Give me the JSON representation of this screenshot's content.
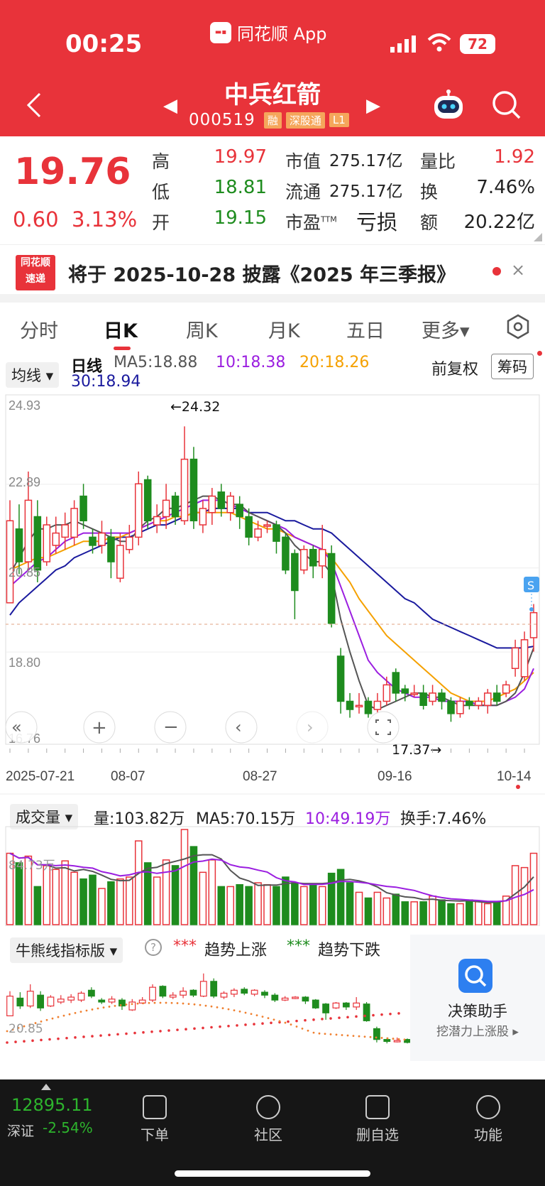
{
  "status_bar": {
    "time": "00:25",
    "battery": "72",
    "app_label": "同花顺 App"
  },
  "header": {
    "stock_name": "中兵红箭",
    "stock_code": "000519",
    "tags": [
      "融",
      "深股通",
      "L1"
    ]
  },
  "quote": {
    "price": "19.76",
    "change": "0.60",
    "change_pct": "3.13%",
    "items": [
      {
        "label": "高",
        "value": "19.97",
        "color": "red"
      },
      {
        "label": "低",
        "value": "18.81",
        "color": "green"
      },
      {
        "label": "开",
        "value": "19.15",
        "color": "green"
      },
      {
        "label": "市值",
        "value": "275.17亿"
      },
      {
        "label": "流通",
        "value": "275.17亿"
      },
      {
        "label": "市盈",
        "label_sup": "TTM",
        "value": "亏损"
      },
      {
        "label": "量比",
        "value": "1.92",
        "color": "red"
      },
      {
        "label": "换",
        "value": "7.46%"
      },
      {
        "label": "额",
        "value": "20.22亿"
      }
    ]
  },
  "notice": {
    "logo": "同花顺速递",
    "text": "将于 2025-10-28 披露《2025 年三季报》",
    "close": "×"
  },
  "tabs": [
    "分时",
    "日K",
    "周K",
    "月K",
    "五日",
    "更多▾"
  ],
  "active_tab": "日K",
  "ma_bar": {
    "dropdown": "均线",
    "label": "日线",
    "ma5": "MA5:18.88",
    "ma10": "10:18.38",
    "ma20": "20:18.26",
    "ma30": "30:18.94",
    "adjust": "前复权",
    "chips": "筹码"
  },
  "chart_data": {
    "type": "candlestick",
    "y_ticks": [
      "24.93",
      "22.89",
      "20.85",
      "18.80",
      "16.76"
    ],
    "x_ticks": [
      "2025-07-21",
      "08-07",
      "08-27",
      "09-16",
      "10-14"
    ],
    "annotations": {
      "high": "←24.32",
      "low": "17.37→",
      "marker": "S"
    },
    "candles": [
      [
        20.0,
        22.0,
        20.9,
        22.5
      ],
      [
        21.8,
        21.0,
        20.7,
        22.4
      ],
      [
        21.0,
        22.5,
        20.8,
        23.2
      ],
      [
        22.1,
        20.8,
        20.5,
        22.5
      ],
      [
        21.0,
        21.9,
        20.9,
        22.1
      ],
      [
        21.4,
        21.7,
        21.2,
        22.1
      ],
      [
        21.6,
        21.9,
        21.3,
        22.2
      ],
      [
        21.6,
        22.3,
        21.4,
        22.5
      ],
      [
        22.6,
        22.0,
        21.8,
        22.9
      ],
      [
        21.6,
        21.4,
        21.2,
        21.8
      ],
      [
        21.4,
        21.7,
        21.2,
        22.0
      ],
      [
        21.6,
        21.0,
        20.6,
        21.8
      ],
      [
        20.6,
        21.4,
        20.5,
        21.7
      ],
      [
        21.3,
        21.6,
        21.2,
        21.9
      ],
      [
        21.6,
        22.9,
        21.4,
        23.2
      ],
      [
        23.0,
        22.0,
        21.8,
        23.1
      ],
      [
        21.9,
        22.1,
        21.7,
        22.4
      ],
      [
        22.1,
        22.5,
        21.8,
        22.9
      ],
      [
        22.6,
        22.1,
        21.9,
        22.7
      ],
      [
        22.0,
        23.5,
        21.9,
        24.3
      ],
      [
        23.5,
        22.0,
        21.8,
        23.8
      ],
      [
        21.9,
        22.3,
        21.7,
        22.5
      ],
      [
        22.2,
        22.6,
        21.9,
        22.8
      ],
      [
        22.7,
        22.3,
        22.1,
        22.9
      ],
      [
        22.2,
        22.6,
        22.0,
        22.7
      ],
      [
        22.4,
        22.1,
        21.8,
        22.6
      ],
      [
        22.1,
        21.6,
        21.4,
        22.3
      ],
      [
        21.6,
        21.8,
        21.5,
        22.0
      ],
      [
        21.9,
        21.9,
        21.7,
        22.0
      ],
      [
        21.9,
        21.5,
        21.2,
        22.0
      ],
      [
        21.6,
        20.8,
        20.7,
        21.7
      ],
      [
        21.2,
        20.3,
        19.6,
        21.3
      ],
      [
        20.8,
        21.3,
        20.7,
        21.4
      ],
      [
        21.3,
        20.9,
        20.6,
        21.4
      ],
      [
        20.9,
        21.3,
        20.6,
        21.9
      ],
      [
        21.2,
        19.5,
        19.4,
        21.4
      ],
      [
        18.7,
        17.6,
        17.3,
        18.9
      ],
      [
        17.6,
        17.4,
        17.2,
        17.8
      ],
      [
        17.5,
        17.5,
        17.3,
        17.8
      ],
      [
        17.6,
        17.3,
        17.2,
        17.7
      ],
      [
        17.4,
        17.6,
        17.3,
        17.8
      ],
      [
        17.6,
        18.0,
        17.5,
        18.2
      ],
      [
        18.3,
        17.8,
        17.6,
        18.4
      ],
      [
        17.9,
        17.8,
        17.6,
        18.0
      ],
      [
        17.8,
        17.8,
        17.7,
        18.0
      ],
      [
        17.8,
        17.5,
        17.4,
        18.0
      ],
      [
        17.6,
        17.8,
        17.5,
        18.0
      ],
      [
        17.8,
        17.6,
        17.4,
        17.9
      ],
      [
        17.6,
        17.3,
        17.1,
        17.7
      ],
      [
        17.3,
        17.6,
        17.2,
        17.7
      ],
      [
        17.6,
        17.5,
        17.4,
        17.7
      ],
      [
        17.5,
        17.6,
        17.4,
        17.7
      ],
      [
        17.5,
        17.8,
        17.3,
        17.9
      ],
      [
        17.8,
        17.6,
        17.5,
        18.0
      ],
      [
        17.8,
        18.0,
        17.7,
        18.1
      ],
      [
        18.4,
        18.9,
        18.2,
        19.1
      ],
      [
        18.2,
        19.1,
        18.1,
        19.3
      ],
      [
        19.15,
        19.76,
        18.81,
        19.97
      ]
    ],
    "ma_series": {
      "ma5": [
        20.7,
        21.1,
        21.5,
        21.8,
        21.8,
        21.9,
        21.9,
        22.0,
        21.9,
        21.8,
        21.7,
        21.6,
        21.5,
        21.5,
        21.8,
        22.0,
        22.1,
        22.3,
        22.3,
        22.4,
        22.5,
        22.6,
        22.6,
        22.5,
        22.4,
        22.4,
        22.2,
        22.1,
        22.0,
        21.9,
        21.7,
        21.4,
        21.2,
        21.0,
        21.0,
        20.7,
        19.6,
        18.8,
        18.1,
        17.5,
        17.4,
        17.5,
        17.6,
        17.7,
        17.8,
        17.8,
        17.7,
        17.7,
        17.6,
        17.5,
        17.5,
        17.5,
        17.5,
        17.5,
        17.6,
        17.8,
        18.3,
        18.9
      ],
      "ma10": [
        20.4,
        20.6,
        20.8,
        21.0,
        21.1,
        21.3,
        21.5,
        21.6,
        21.7,
        21.7,
        21.7,
        21.7,
        21.7,
        21.7,
        21.8,
        21.9,
        22.0,
        22.1,
        22.2,
        22.3,
        22.4,
        22.5,
        22.5,
        22.5,
        22.4,
        22.3,
        22.2,
        22.1,
        22.0,
        21.9,
        21.8,
        21.6,
        21.5,
        21.4,
        21.3,
        21.0,
        20.4,
        19.8,
        19.2,
        18.6,
        18.3,
        18.1,
        17.9,
        17.8,
        17.7,
        17.7,
        17.7,
        17.6,
        17.6,
        17.6,
        17.6,
        17.5,
        17.5,
        17.5,
        17.6,
        17.7,
        17.9,
        18.4
      ],
      "ma20": [
        20.8,
        20.9,
        21.0,
        21.1,
        21.1,
        21.2,
        21.3,
        21.4,
        21.5,
        21.5,
        21.5,
        21.6,
        21.6,
        21.7,
        21.8,
        21.9,
        22.0,
        22.0,
        22.1,
        22.1,
        22.2,
        22.2,
        22.2,
        22.2,
        22.2,
        22.1,
        22.0,
        21.9,
        21.8,
        21.8,
        21.7,
        21.6,
        21.5,
        21.4,
        21.3,
        21.1,
        20.8,
        20.5,
        20.1,
        19.8,
        19.5,
        19.2,
        19.0,
        18.8,
        18.6,
        18.4,
        18.2,
        18.0,
        17.8,
        17.7,
        17.6,
        17.6,
        17.6,
        17.7,
        17.8,
        17.9,
        18.1,
        18.3
      ],
      "ma30": [
        19.7,
        20.0,
        20.2,
        20.4,
        20.6,
        20.8,
        20.9,
        21.1,
        21.2,
        21.3,
        21.4,
        21.5,
        21.6,
        21.6,
        21.7,
        21.8,
        21.9,
        21.9,
        22.0,
        22.1,
        22.2,
        22.2,
        22.3,
        22.3,
        22.3,
        22.3,
        22.2,
        22.2,
        22.2,
        22.1,
        22.0,
        22.0,
        21.9,
        21.8,
        21.8,
        21.7,
        21.5,
        21.3,
        21.1,
        20.9,
        20.7,
        20.5,
        20.3,
        20.1,
        20.0,
        19.8,
        19.6,
        19.5,
        19.4,
        19.3,
        19.2,
        19.1,
        19.0,
        18.9,
        18.9,
        18.9,
        18.9,
        18.94
      ]
    },
    "ma_colors": {
      "ma5": "#555555",
      "ma10": "#9b1ee0",
      "ma20": "#f5a100",
      "ma30": "#1a1a9e"
    }
  },
  "volume": {
    "dropdown": "成交量",
    "vol": "量:103.82万",
    "ma5": "MA5:70.15万",
    "ma10": "10:49.19万",
    "turnover": "换手:7.46%",
    "level": "84.73万",
    "values": [
      75,
      65,
      72,
      40,
      62,
      58,
      67,
      55,
      48,
      52,
      38,
      45,
      48,
      50,
      88,
      65,
      50,
      68,
      62,
      100,
      82,
      55,
      68,
      40,
      40,
      42,
      40,
      44,
      42,
      40,
      50,
      44,
      40,
      42,
      40,
      54,
      58,
      44,
      34,
      28,
      34,
      28,
      32,
      24,
      24,
      24,
      30,
      26,
      22,
      22,
      26,
      24,
      22,
      24,
      30,
      62,
      60,
      75
    ]
  },
  "bull_bear": {
    "dropdown": "牛熊线指标版",
    "help": "?",
    "legend_up_mark": "***",
    "legend_up": "趋势上涨",
    "legend_down_mark": "***",
    "legend_down": "趋势下跌",
    "level": "20.85"
  },
  "assistant": {
    "title": "决策助手",
    "sub": "挖潜力上涨股 ▸"
  },
  "bottom_nav": {
    "index_value": "12895.11",
    "index_name": "深证",
    "index_change": "-2.54%",
    "items": [
      "下单",
      "社区",
      "删自选",
      "功能"
    ]
  },
  "colors": {
    "up": "#e8333a",
    "down": "#1e8c1e",
    "header": "#e8333a"
  }
}
